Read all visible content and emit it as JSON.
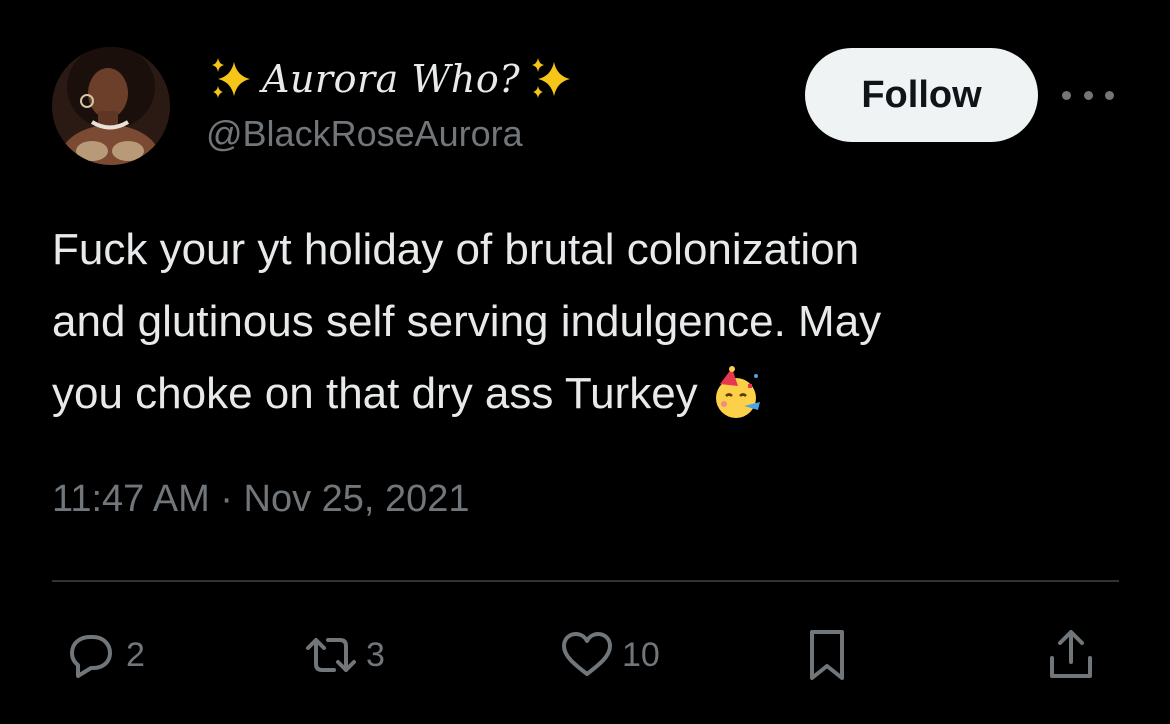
{
  "user": {
    "display_name": "Aurora Who?",
    "handle": "@BlackRoseAurora",
    "avatar": "profile-photo"
  },
  "header": {
    "follow_label": "Follow",
    "more_icon": "more-icon"
  },
  "tweet": {
    "lines": [
      "Fuck your yt holiday of brutal colonization",
      "and glutinous self serving indulgence. May",
      "you choke on that dry ass Turkey"
    ],
    "emoji": "partying-face-emoji"
  },
  "meta": {
    "time": "11:47 AM",
    "separator": "·",
    "date": "Nov 25, 2021"
  },
  "actions": {
    "replies": "2",
    "retweets": "3",
    "likes": "10"
  },
  "colors": {
    "background": "#000000",
    "text": "#e7e9ea",
    "muted": "#71767b",
    "button_bg": "#eff3f4",
    "divider": "#2f3336"
  }
}
